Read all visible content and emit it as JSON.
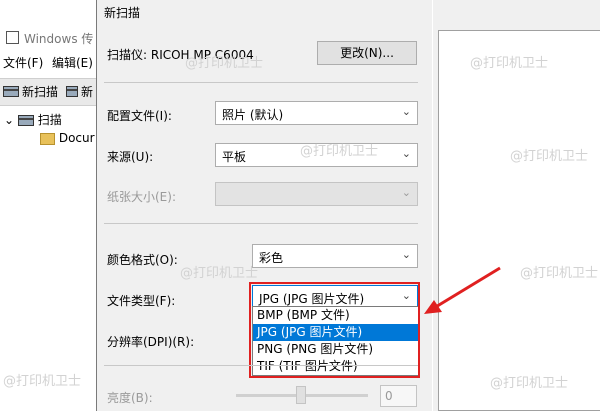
{
  "background_window": {
    "title": "Windows 传",
    "menu": [
      "文件(F)",
      "编辑(E)"
    ],
    "toolbar": [
      "新扫描",
      "新"
    ],
    "tree": {
      "root": "扫描",
      "child": "Docur"
    }
  },
  "dialog": {
    "title": "新扫描",
    "scanner_label": "扫描仪: RICOH MP C6004",
    "change_button": "更改(N)...",
    "profile": {
      "label": "配置文件(I):",
      "value": "照片 (默认)"
    },
    "source": {
      "label": "来源(U):",
      "value": "平板"
    },
    "paper_size": {
      "label": "纸张大小(E):",
      "value": ""
    },
    "color_format": {
      "label": "颜色格式(O):",
      "value": "彩色"
    },
    "file_type": {
      "label": "文件类型(F):",
      "value": "JPG (JPG 图片文件)",
      "options": [
        "BMP (BMP 文件)",
        "JPG (JPG 图片文件)",
        "PNG (PNG 图片文件)",
        "TIF (TIF 图片文件)"
      ],
      "selected_index": 1
    },
    "resolution": {
      "label": "分辨率(DPI)(R):"
    },
    "brightness": {
      "label": "亮度(B):",
      "value": "0"
    }
  },
  "watermark": "@打印机卫士",
  "colors": {
    "accent": "#0078d7",
    "highlight": "#e02020"
  }
}
